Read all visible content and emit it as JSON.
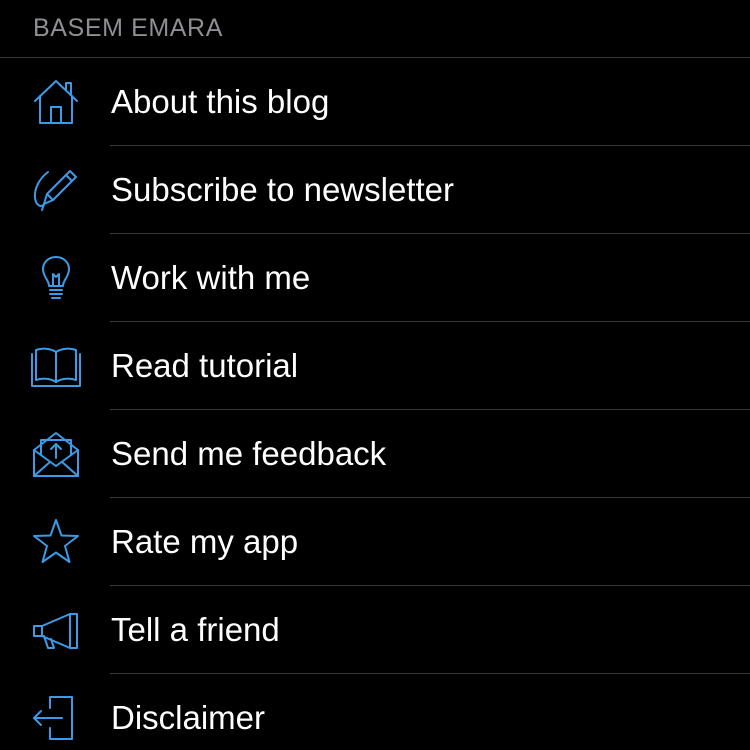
{
  "section": {
    "title": "BASEM EMARA"
  },
  "menu": {
    "items": [
      {
        "label": "About this blog",
        "icon": "home-icon"
      },
      {
        "label": "Subscribe to newsletter",
        "icon": "pencil-icon"
      },
      {
        "label": "Work with me",
        "icon": "lightbulb-icon"
      },
      {
        "label": "Read tutorial",
        "icon": "book-icon"
      },
      {
        "label": "Send me feedback",
        "icon": "envelope-icon"
      },
      {
        "label": "Rate my app",
        "icon": "star-icon"
      },
      {
        "label": "Tell a friend",
        "icon": "megaphone-icon"
      },
      {
        "label": "Disclaimer",
        "icon": "exit-icon"
      }
    ]
  },
  "colors": {
    "background": "#000000",
    "accent": "#3b9be6",
    "header_text": "#8e8e93",
    "separator": "#38383a",
    "label_text": "#ffffff"
  }
}
